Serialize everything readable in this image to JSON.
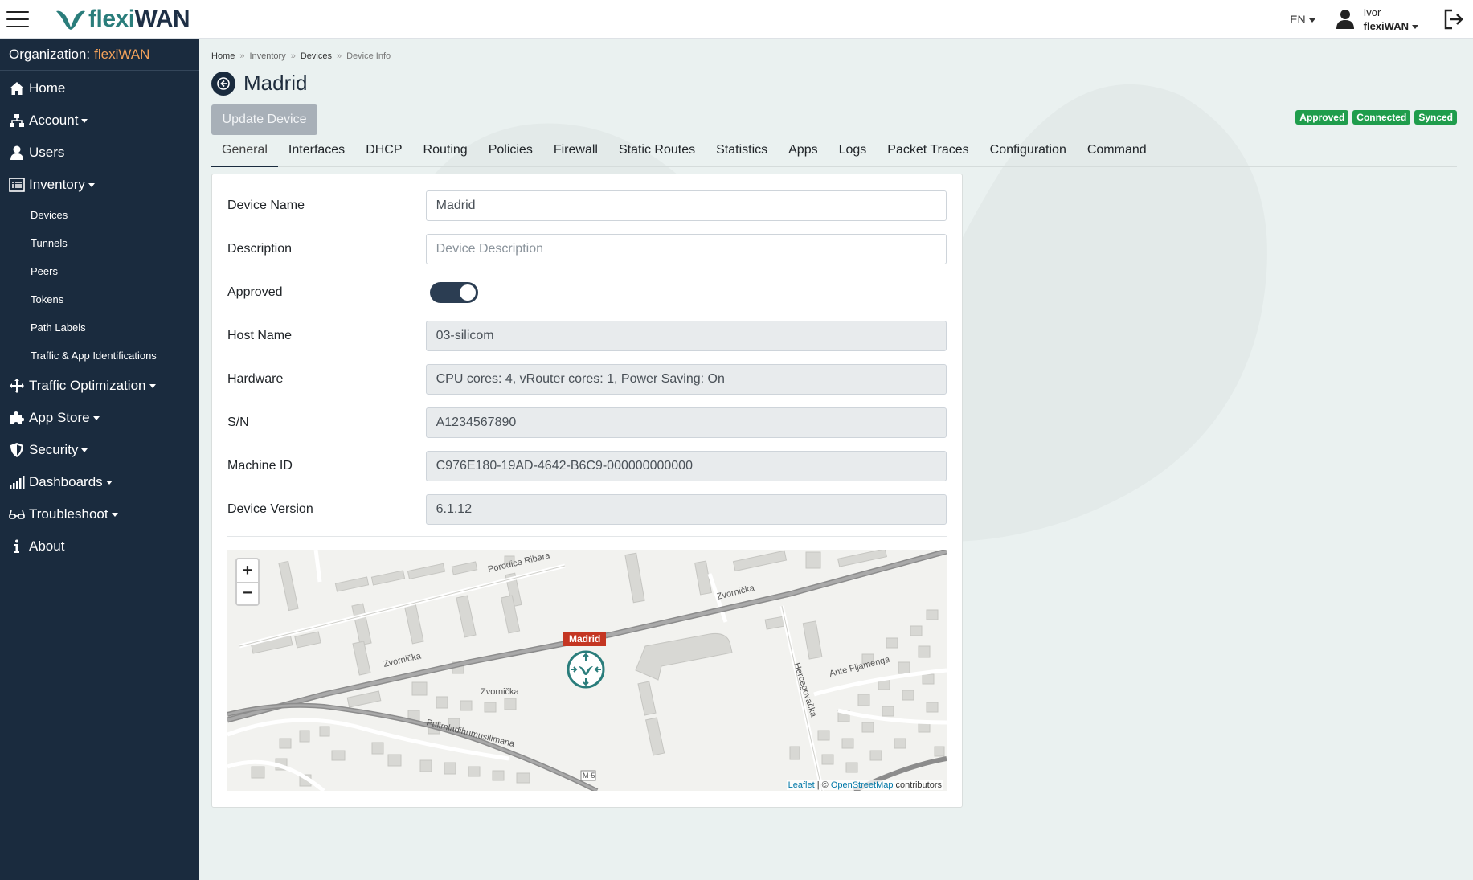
{
  "app": {
    "logo_part1": "flexi",
    "logo_part2": "WAN",
    "language": "EN",
    "user_name": "Ivor",
    "user_org": "flexiWAN"
  },
  "sidebar": {
    "org_label": "Organization:",
    "org_name": "flexiWAN",
    "items": [
      {
        "label": "Home",
        "icon": "home-icon"
      },
      {
        "label": "Account",
        "icon": "sitemap-icon",
        "dropdown": true
      },
      {
        "label": "Users",
        "icon": "user-icon"
      },
      {
        "label": "Inventory",
        "icon": "list-icon",
        "dropdown": true
      },
      {
        "label": "Traffic Optimization",
        "icon": "arrows-icon",
        "dropdown": true
      },
      {
        "label": "App Store",
        "icon": "puzzle-icon",
        "dropdown": true
      },
      {
        "label": "Security",
        "icon": "shield-icon",
        "dropdown": true
      },
      {
        "label": "Dashboards",
        "icon": "signal-icon",
        "dropdown": true
      },
      {
        "label": "Troubleshoot",
        "icon": "glasses-icon",
        "dropdown": true
      },
      {
        "label": "About",
        "icon": "info-icon"
      }
    ],
    "inventory_sub": [
      "Devices",
      "Tunnels",
      "Peers",
      "Tokens",
      "Path Labels",
      "Traffic & App Identifications"
    ]
  },
  "breadcrumb": [
    "Home",
    "Inventory",
    "Devices",
    "Device Info"
  ],
  "page": {
    "title": "Madrid",
    "update_button": "Update Device",
    "badges": [
      "Approved",
      "Connected",
      "Synced"
    ],
    "badge_color": "#1f9d4c"
  },
  "tabs": [
    "General",
    "Interfaces",
    "DHCP",
    "Routing",
    "Policies",
    "Firewall",
    "Static Routes",
    "Statistics",
    "Apps",
    "Logs",
    "Packet Traces",
    "Configuration",
    "Command"
  ],
  "active_tab": "General",
  "form": {
    "device_name_label": "Device Name",
    "device_name_value": "Madrid",
    "description_label": "Description",
    "description_placeholder": "Device Description",
    "approved_label": "Approved",
    "approved": true,
    "host_name_label": "Host Name",
    "host_name_value": "03-silicom",
    "hardware_label": "Hardware",
    "hardware_value": "CPU cores: 4, vRouter cores: 1, Power Saving: On",
    "sn_label": "S/N",
    "sn_value": "A1234567890",
    "machine_id_label": "Machine ID",
    "machine_id_value": "C976E180-19AD-4642-B6C9-000000000000",
    "device_version_label": "Device Version",
    "device_version_value": "6.1.12"
  },
  "map": {
    "zoom_in": "+",
    "zoom_out": "−",
    "marker_label": "Madrid",
    "street_labels": [
      "Porodice Ribara",
      "Zvornička",
      "Zvornička",
      "Zvornička",
      "Pulimladihumusilimana",
      "Hercegovačka",
      "Ante Fijamenga",
      "M-5"
    ],
    "attribution_leaflet": "Leaflet",
    "attribution_sep": " | © ",
    "attribution_osm": "OpenStreetMap",
    "attribution_suffix": " contributors"
  }
}
